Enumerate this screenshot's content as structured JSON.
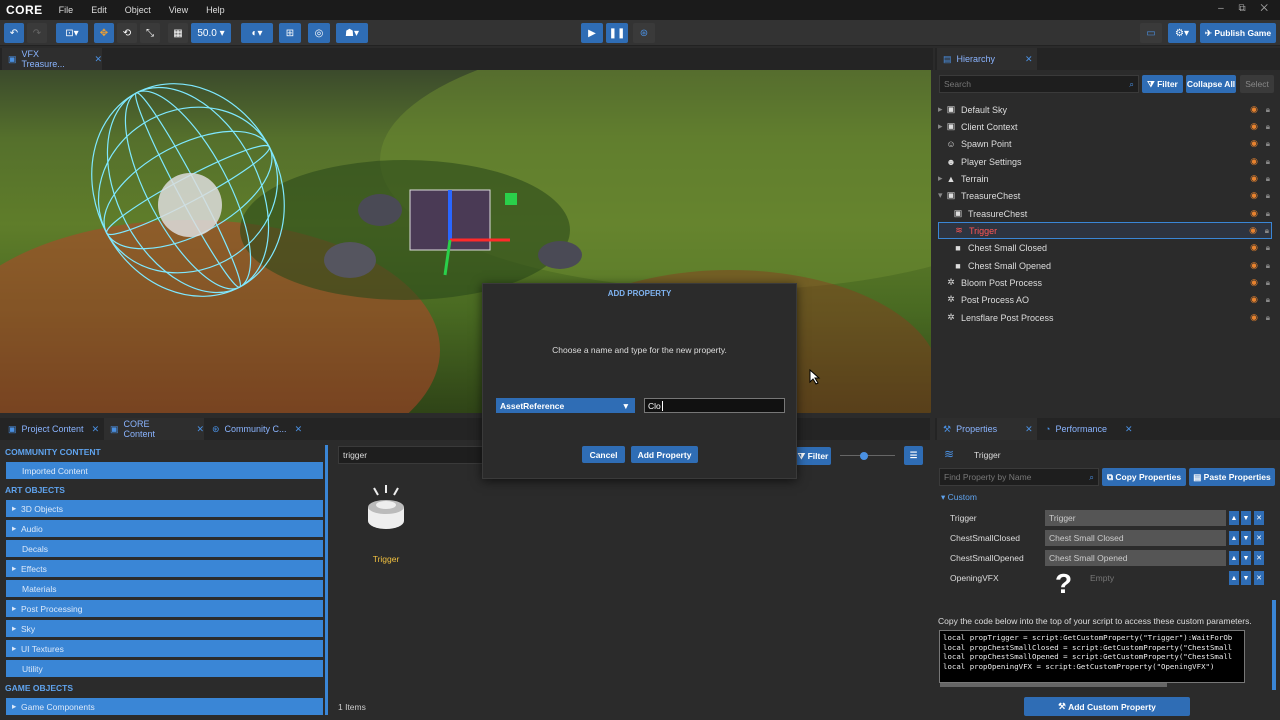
{
  "app": {
    "logo": "CORE",
    "window_controls": "– ⧉ ✕"
  },
  "menu": [
    "File",
    "Edit",
    "Object",
    "View",
    "Help"
  ],
  "toolbar": {
    "grid_size": "50.0",
    "publish_label": "Publish Game"
  },
  "viewport_tab": {
    "label": "VFX Treasure..."
  },
  "hierarchy": {
    "tab_label": "Hierarchy",
    "search_placeholder": "Search",
    "filter_label": "Filter",
    "collapse_label": "Collapse All",
    "select_label": "Select",
    "items": [
      {
        "label": "Default Sky",
        "icon": "▣"
      },
      {
        "label": "Client Context",
        "icon": "▣"
      },
      {
        "label": "Spawn Point",
        "icon": "☺"
      },
      {
        "label": "Player Settings",
        "icon": "☻"
      },
      {
        "label": "Terrain",
        "icon": "▲"
      },
      {
        "label": "TreasureChest",
        "icon": "▣"
      },
      {
        "label": "TreasureChest",
        "icon": "▣"
      },
      {
        "label": "Trigger",
        "icon": "≋"
      },
      {
        "label": "Chest Small Closed",
        "icon": "■"
      },
      {
        "label": "Chest Small Opened",
        "icon": "■"
      },
      {
        "label": "Bloom Post Process",
        "icon": "✲"
      },
      {
        "label": "Post Process AO",
        "icon": "✲"
      },
      {
        "label": "Lensflare Post Process",
        "icon": "✲"
      }
    ]
  },
  "content_tabs": [
    "Project Content",
    "CORE Content",
    "Community C..."
  ],
  "content": {
    "community_header": "COMMUNITY CONTENT",
    "imported": "Imported Content",
    "art_header": "ART OBJECTS",
    "art_items": [
      "3D Objects",
      "Audio",
      "Decals",
      "Effects",
      "Materials",
      "Post Processing",
      "Sky",
      "UI Textures",
      "Utility"
    ],
    "game_header": "GAME OBJECTS",
    "game_items": [
      "Game Components"
    ],
    "search_value": "trigger",
    "filter_label": "Filter",
    "result_label": "Trigger",
    "items_count": "1 Items"
  },
  "modal": {
    "title": "ADD PROPERTY",
    "message": "Choose a name and type for the new property.",
    "type_value": "AssetReference",
    "name_value": "Clo",
    "cancel_label": "Cancel",
    "add_label": "Add Property"
  },
  "properties": {
    "tab_label": "Properties",
    "perf_tab_label": "Performance",
    "object_name": "Trigger",
    "find_placeholder": "Find Property by Name",
    "copy_label": "Copy Properties",
    "paste_label": "Paste Properties",
    "section": "Custom",
    "rows": [
      {
        "name": "Trigger",
        "value": "Trigger"
      },
      {
        "name": "ChestSmallClosed",
        "value": "Chest Small Closed"
      },
      {
        "name": "ChestSmallOpened",
        "value": "Chest Small Opened"
      },
      {
        "name": "OpeningVFX",
        "value": "Empty"
      }
    ],
    "copy_hint": "Copy the code below into the top of your script to access these custom parameters.",
    "code": "local propTrigger = script:GetCustomProperty(\"Trigger\"):WaitForOb\nlocal propChestSmallClosed = script:GetCustomProperty(\"ChestSmall\nlocal propChestSmallOpened = script:GetCustomProperty(\"ChestSmall\nlocal propOpeningVFX = script:GetCustomProperty(\"OpeningVFX\")",
    "add_custom_label": "Add Custom Property"
  }
}
